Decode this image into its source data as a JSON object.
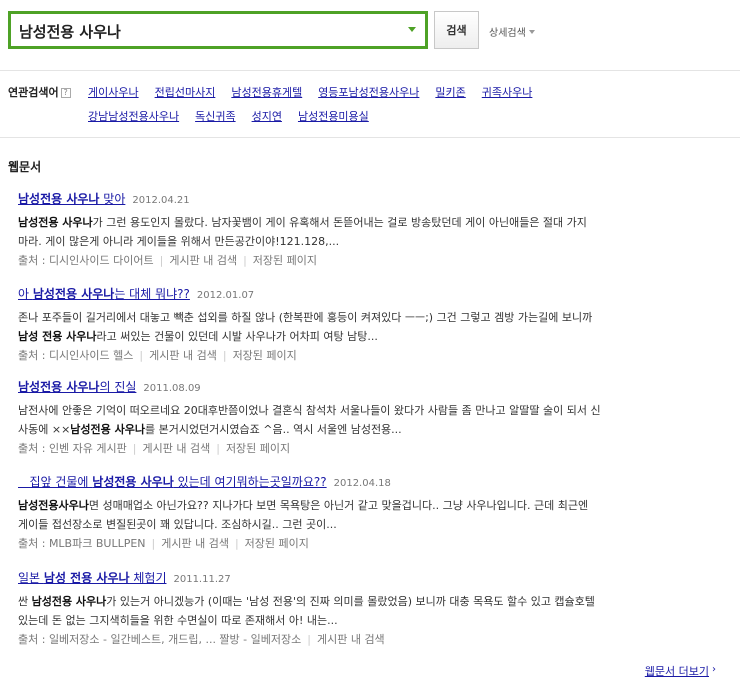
{
  "search": {
    "query": "남성전용 사우나",
    "button_label": "검색",
    "advanced_label": "상세검색"
  },
  "related": {
    "title": "연관검색어",
    "help": "?",
    "row1": [
      "게이사우나",
      "전립선마사지",
      "남성전용휴게텔",
      "영등포남성전용사우나",
      "밀키존",
      "귀족사우나"
    ],
    "row2": [
      "강남남성전용사우나",
      "독신귀족",
      "성지연",
      "남성전용미용실"
    ]
  },
  "section_title": "웹문서",
  "results": [
    {
      "title_bold": "남성전용 사우나",
      "title_pre": "",
      "title_post": " 맞아",
      "date": "2012.04.21",
      "line1_bold": "남성전용 사우나",
      "line1_rest": "가 그런 용도인지 몰랐다. 남자꽃뱀이 게이 유혹해서 돈뜯어내는 걸로 방송탔던데 게이 아닌애들은 절대 가지",
      "line2": "마라. 게이 많은게 아니라 게이들을 위해서 만든공간이야!121.128,...",
      "source": "출처 : 디시인사이드 다이어트",
      "link1": "게시판 내 검색",
      "link2": "저장된 페이지"
    },
    {
      "title_pre": "아 ",
      "title_bold": "남성전용 사우나",
      "title_post": "는 대체 뭐냐??",
      "date": "2012.01.07",
      "line1": "존나 포주들이 길거리에서 대놓고 빽춘 섭외를 하질 않나 (한복판에 홍등이 켜져있다 ㅡㅡ;) 그건 그렇고 겜방 가는길에 보니까",
      "line2_bold": "남성 전용 사우나",
      "line2_rest": "라고 써있는 건물이 있던데 시발 사우나가 어차피 여탕 남탕...",
      "source": "출처 : 디시인사이드 헬스",
      "link1": "게시판 내 검색",
      "link2": "저장된 페이지"
    },
    {
      "title_pre": "",
      "title_bold": "남성전용 사우나",
      "title_post": "의 진실",
      "date": "2011.08.09",
      "line1": "남전사에 안좋은 기억이 떠오르네요 20대후반쯤이었나 결혼식 참석차 서울나들이 왔다가 사람들 좀 만나고 알딸딸 술이 되서 신",
      "line2_pre": "사동에 ××",
      "line2_bold": "남성전용 사우나",
      "line2_rest": "를 본거시었던거시였습죠 ^음.. 역시 서울엔 남성전용...",
      "source": "출처 : 인벤 자유 게시판",
      "link1": "게시판 내 검색",
      "link2": "저장된 페이지"
    },
    {
      "title_pre": "   집앞 건물에 ",
      "title_bold": "남성전용 사우나",
      "title_post": " 있는데 여기뭐하는곳일까요??",
      "date": "2012.04.18",
      "line1_bold": "남성전용사우나",
      "line1_rest": "면 성매매업소 아닌가요?? 지나가다 보면 목욕탕은 아닌거 같고 맞을겁니다.. 그냥 사우나입니다. 근데 최근엔",
      "line2": "게이들 접선장소로 변질된곳이 꽤 있답니다. 조심하시길.. 그런 곳이...",
      "source": "출처 : MLB파크 BULLPEN",
      "link1": "게시판 내 검색",
      "link2": "저장된 페이지"
    },
    {
      "title_pre": "일본 ",
      "title_bold": "남성 전용 사우나",
      "title_post": " 체험기",
      "date": "2011.11.27",
      "line1_pre": "싼 ",
      "line1_bold": "남성전용 사우나",
      "line1_rest": "가 있는거 아니겠능가 (이때는 '남성 전용'의 진짜 의미를 몰랐었음) 보니까 대충 목욕도 할수 있고 캡슐호텔",
      "line2": "있는데 돈 없는 그지색히들을 위한 수면실이 따로 존재해서 아! 내는...",
      "source": "출처 : 일베저장소 - 일간베스트, 개드립, ... 짤방 - 일베저장소",
      "link1": "게시판 내 검색"
    }
  ],
  "more_label": "웹문서 더보기",
  "more_arrow": "›"
}
